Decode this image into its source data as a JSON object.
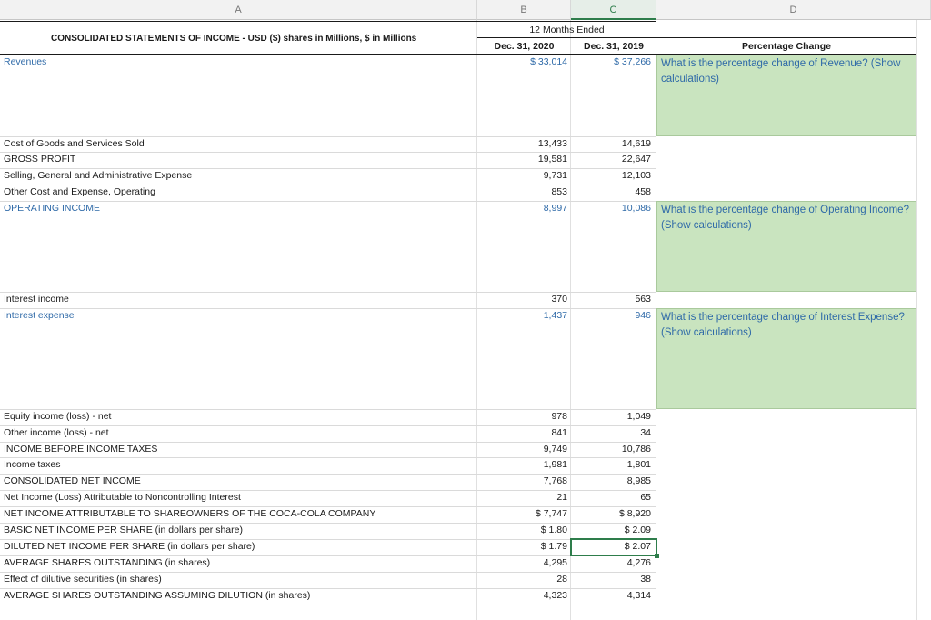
{
  "columns": [
    "A",
    "B",
    "C",
    "D"
  ],
  "header": {
    "title": "CONSOLIDATED STATEMENTS OF INCOME - USD ($) shares in Millions, $ in Millions",
    "period": "12 Months Ended",
    "col_b": "Dec. 31, 2020",
    "col_c": "Dec. 31, 2019",
    "col_d": "Percentage Change"
  },
  "rows": [
    {
      "label": "Revenues",
      "b": "$ 33,014",
      "c": "$ 37,266"
    },
    {
      "label": "Cost of Goods and Services Sold",
      "b": "13,433",
      "c": "14,619"
    },
    {
      "label": "GROSS PROFIT",
      "b": "19,581",
      "c": "22,647"
    },
    {
      "label": "Selling, General and Administrative Expense",
      "b": "9,731",
      "c": "12,103"
    },
    {
      "label": "Other Cost and Expense, Operating",
      "b": "853",
      "c": "458"
    },
    {
      "label": "OPERATING INCOME",
      "b": "8,997",
      "c": "10,086"
    },
    {
      "label": "Interest income",
      "b": "370",
      "c": "563"
    },
    {
      "label": "Interest expense",
      "b": "1,437",
      "c": "946"
    },
    {
      "label": "Equity income (loss) - net",
      "b": "978",
      "c": "1,049"
    },
    {
      "label": "Other income (loss) - net",
      "b": "841",
      "c": "34"
    },
    {
      "label": "INCOME BEFORE INCOME TAXES",
      "b": "9,749",
      "c": "10,786"
    },
    {
      "label": "Income taxes",
      "b": "1,981",
      "c": "1,801"
    },
    {
      "label": "CONSOLIDATED NET INCOME",
      "b": "7,768",
      "c": "8,985"
    },
    {
      "label": "Net Income (Loss) Attributable to Noncontrolling Interest",
      "b": "21",
      "c": "65"
    },
    {
      "label": "NET INCOME ATTRIBUTABLE TO SHAREOWNERS OF THE COCA-COLA COMPANY",
      "b": "$ 7,747",
      "c": "$ 8,920"
    },
    {
      "label": "BASIC NET INCOME PER SHARE (in dollars per share)",
      "b": "$ 1.80",
      "c": "$ 2.09"
    },
    {
      "label": "DILUTED NET INCOME PER SHARE (in dollars per share)",
      "b": "$ 1.79",
      "c": "$ 2.07"
    },
    {
      "label": "AVERAGE SHARES OUTSTANDING (in shares)",
      "b": "4,295",
      "c": "4,276"
    },
    {
      "label": "Effect of dilutive securities (in shares)",
      "b": "28",
      "c": "38"
    },
    {
      "label": "AVERAGE SHARES OUTSTANDING ASSUMING DILUTION (in shares)",
      "b": "4,323",
      "c": "4,314"
    }
  ],
  "questions": [
    "What is the percentage change of Revenue? (Show calculations)",
    "What is the percentage change of Operating Income?  (Show calculations)",
    "What is the percentage change of Interest Expense?  (Show calculations)"
  ]
}
